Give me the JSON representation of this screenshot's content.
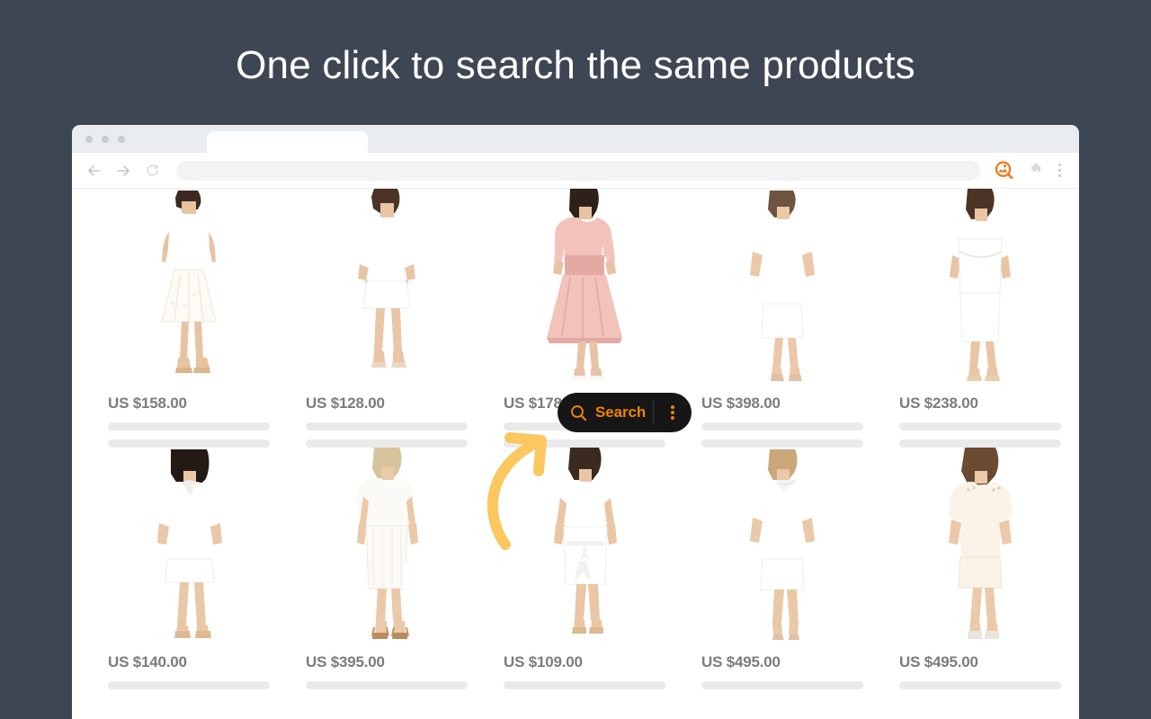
{
  "headline": "One click to search the same products",
  "browser": {
    "window_controls": [
      "close-dot",
      "minimize-dot",
      "maximize-dot"
    ],
    "tab": {
      "title": ""
    },
    "toolbar": {
      "back_icon": "arrow-left-icon",
      "forward_icon": "arrow-right-icon",
      "reload_icon": "reload-icon",
      "address_value": "",
      "address_placeholder": "",
      "extension_icon": "image-search-extension-icon",
      "extensions_icon": "puzzle-piece-icon",
      "menu_icon": "kebab-menu-icon"
    }
  },
  "overlay": {
    "search_button": {
      "label": "Search",
      "icon": "magnifier-icon",
      "menu_icon": "kebab-menu-icon",
      "background": "#161616",
      "accent": "#f08200"
    },
    "arrow": {
      "name": "curved-arrow",
      "color": "#fbc75f"
    }
  },
  "colors": {
    "page_background": "#3e4553",
    "brand_orange": "#f4700e",
    "price_text": "#7c7c7c",
    "skeleton": "#eaeaea"
  },
  "products": [
    {
      "price": "US $158.00",
      "alt": "white sleeveless halter lace fit-and-flare midi dress",
      "dress": "#ffffff",
      "shade": "#f3efe6",
      "style": "flare",
      "sleeve": "none",
      "hair": "#3a2a21"
    },
    {
      "price": "US $128.00",
      "alt": "white long-sleeve a-line mini dress",
      "dress": "#ffffff",
      "shade": "#efefee",
      "style": "aline",
      "sleeve": "long",
      "hair": "#4a3326"
    },
    {
      "price": "US $178.00",
      "alt": "blush pink elbow-sleeve fit-and-flare midi dress",
      "dress": "#f2c2bb",
      "shade": "#e3aaa3",
      "style": "flare",
      "sleeve": "mid",
      "hair": "#2f2119"
    },
    {
      "price": "US $398.00",
      "alt": "white short-sleeve shift dress",
      "dress": "#ffffff",
      "shade": "#eeeeed",
      "style": "shift",
      "sleeve": "short",
      "hair": "#6d5340"
    },
    {
      "price": "US $238.00",
      "alt": "white cold-shoulder twist-front sheath dress",
      "dress": "#ffffff",
      "shade": "#ecebe8",
      "style": "sheath",
      "sleeve": "none",
      "hair": "#4b3426"
    },
    {
      "price": "US $140.00",
      "alt": "white v-neck three-quarter sleeve shift mini dress",
      "dress": "#ffffff",
      "shade": "#eeeeec",
      "style": "aline",
      "sleeve": "long",
      "hair": "#241a15"
    },
    {
      "price": "US $395.00",
      "alt": "white sleeveless ribbed body-con midi dress",
      "dress": "#fbfaf6",
      "shade": "#eceade",
      "style": "column",
      "sleeve": "none",
      "hair": "#d8c49c"
    },
    {
      "price": "US $109.00",
      "alt": "white sleeveless tie-waist wrap dress",
      "dress": "#ffffff",
      "shade": "#ededea",
      "style": "wrap",
      "sleeve": "none",
      "hair": "#3b2a20"
    },
    {
      "price": "US $495.00",
      "alt": "white asymmetric-neck short-sleeve sheath dress",
      "dress": "#ffffff",
      "shade": "#eeeeeb",
      "style": "shift",
      "sleeve": "short",
      "hair": "#caa87a"
    },
    {
      "price": "US $495.00",
      "alt": "ivory short-sleeve button-shoulder sheath dress",
      "dress": "#fbf3e7",
      "shade": "#efe3d0",
      "style": "shift",
      "sleeve": "short",
      "hair": "#6b4a32"
    }
  ]
}
